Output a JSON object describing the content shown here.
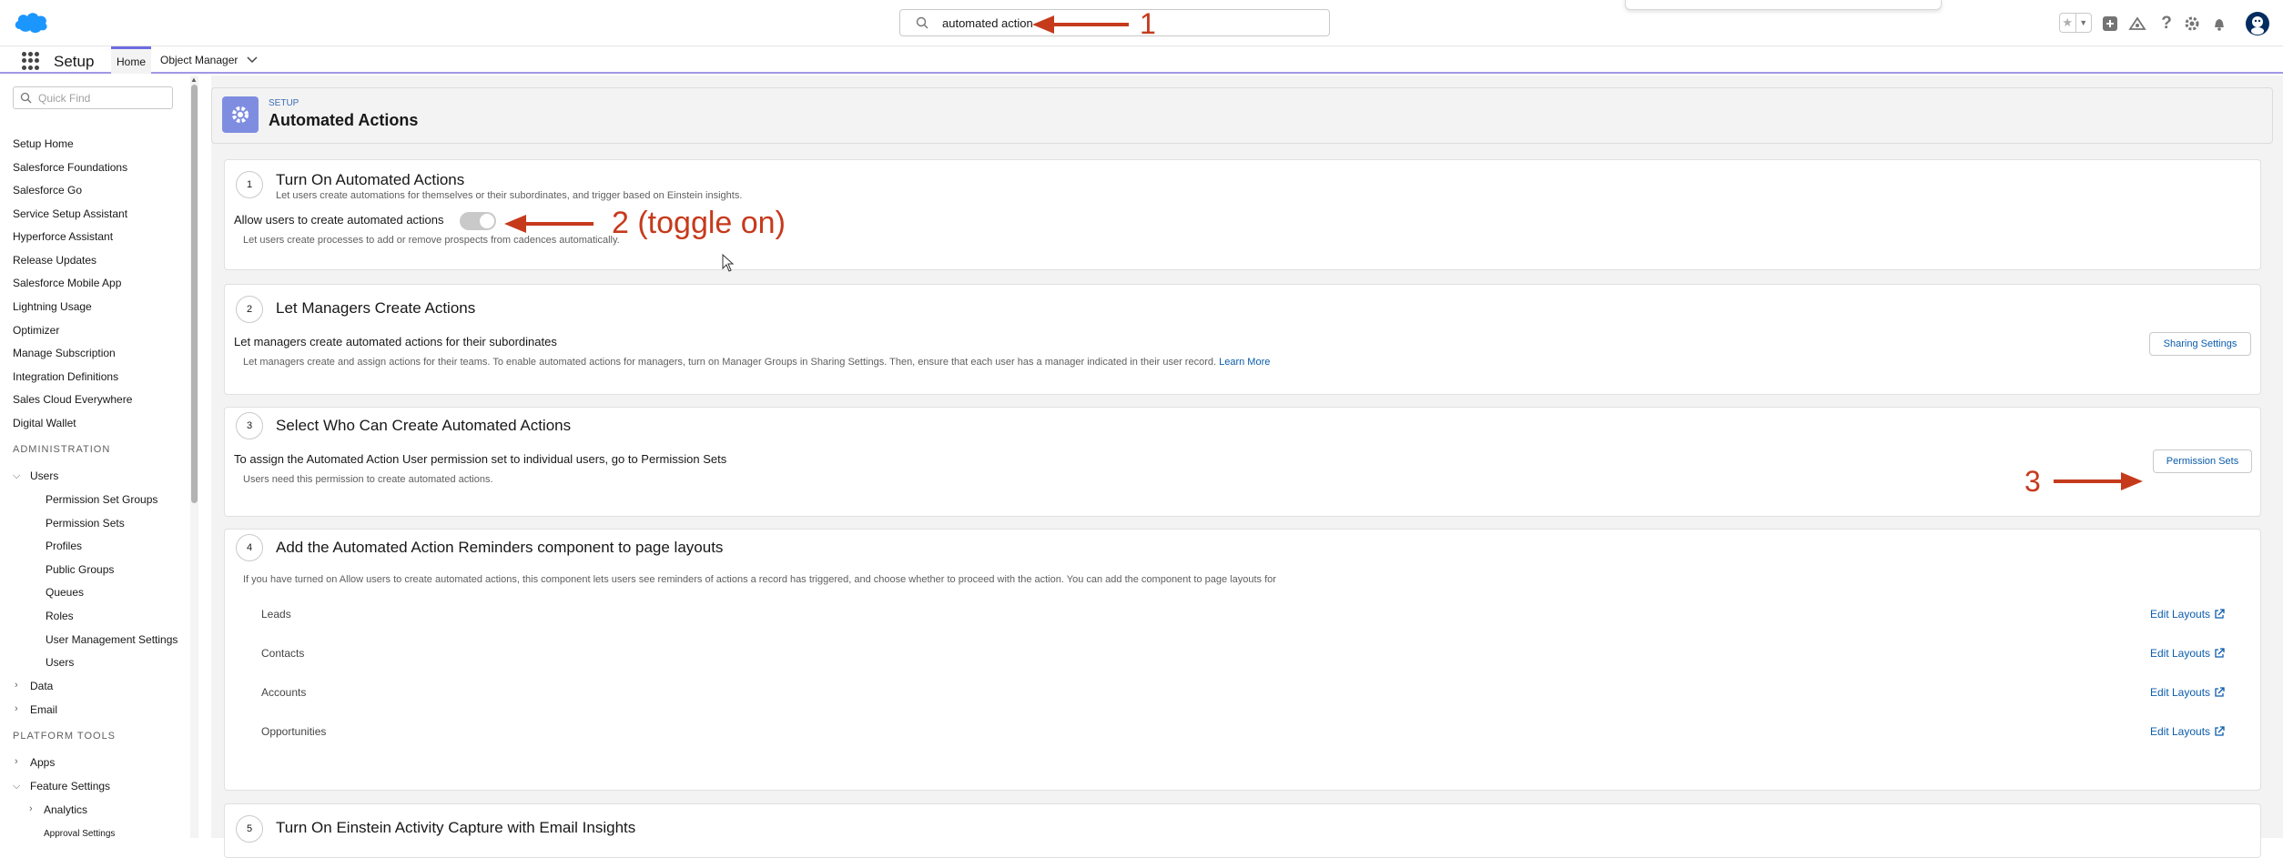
{
  "header": {
    "search_value": "automated action",
    "icons": [
      "favorites-star-icon",
      "favorites-list-icon",
      "global-actions-icon",
      "trailhead-icon",
      "help-icon",
      "setup-gear-icon",
      "notifications-bell-icon",
      "user-avatar-icon"
    ]
  },
  "context_bar": {
    "app_name": "Setup",
    "tabs": [
      {
        "label": "Home",
        "active": true
      },
      {
        "label": "Object Manager",
        "dropdown": true
      }
    ]
  },
  "sidebar": {
    "quick_find_placeholder": "Quick Find",
    "items": [
      "Setup Home",
      "Salesforce Foundations",
      "Salesforce Go",
      "Service Setup Assistant",
      "Hyperforce Assistant",
      "Release Updates",
      "Salesforce Mobile App",
      "Lightning Usage",
      "Optimizer",
      "Manage Subscription",
      "Integration Definitions",
      "Sales Cloud Everywhere",
      "Digital Wallet"
    ],
    "admin_heading": "ADMINISTRATION",
    "users_label": "Users",
    "users_children": [
      "Permission Set Groups",
      "Permission Sets",
      "Profiles",
      "Public Groups",
      "Queues",
      "Roles",
      "User Management Settings",
      "Users"
    ],
    "data_label": "Data",
    "email_label": "Email",
    "platform_heading": "PLATFORM TOOLS",
    "apps_label": "Apps",
    "feature_settings_label": "Feature Settings",
    "analytics_label": "Analytics",
    "partial_label": "Approval Settings"
  },
  "page_header": {
    "eyebrow": "SETUP",
    "title": "Automated Actions"
  },
  "steps": [
    {
      "num": "1",
      "title": "Turn On Automated Actions",
      "subtitle": "Let users create automations for themselves or their subordinates, and trigger based on Einstein insights.",
      "toggle_label": "Allow users to create automated actions",
      "toggle_help": "Let users create processes to add or remove prospects from cadences automatically."
    },
    {
      "num": "2",
      "title": "Let Managers Create Actions",
      "label": "Let managers create automated actions for their subordinates",
      "help": "Let managers create and assign actions for their teams. To enable automated actions for managers, turn on Manager Groups in Sharing Settings. Then, ensure that each user has a manager indicated in their user record.",
      "learn_more": "Learn More",
      "button": "Sharing Settings"
    },
    {
      "num": "3",
      "title": "Select Who Can Create Automated Actions",
      "label": "To assign the Automated Action User permission set to individual users, go to Permission Sets",
      "help": "Users need this permission to create automated actions.",
      "button": "Permission Sets"
    },
    {
      "num": "4",
      "title": "Add the Automated Action Reminders component to page layouts",
      "help": "If you have turned on Allow users to create automated actions, this component lets users see reminders of actions a record has triggered, and choose whether to proceed with the action. You can add the component to page layouts for",
      "objects": [
        "Leads",
        "Contacts",
        "Accounts",
        "Opportunities"
      ],
      "edit_label": "Edit Layouts"
    },
    {
      "num": "5",
      "title": "Turn On Einstein Activity Capture with Email Insights"
    }
  ],
  "annotations": {
    "a1": "1",
    "a2": "2 (toggle on)",
    "a3": "3",
    "color": "#c63a1c"
  }
}
